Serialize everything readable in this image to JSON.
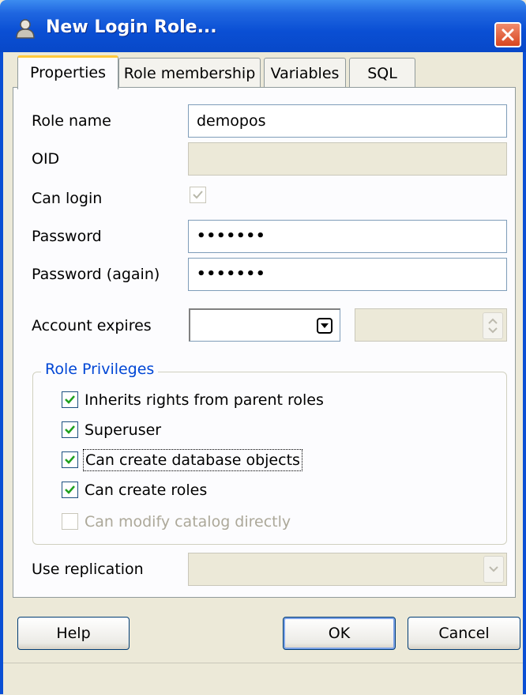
{
  "window": {
    "title": "New Login Role..."
  },
  "tabs": [
    {
      "label": "Properties",
      "active": true
    },
    {
      "label": "Role membership",
      "active": false
    },
    {
      "label": "Variables",
      "active": false
    },
    {
      "label": "SQL",
      "active": false
    }
  ],
  "form": {
    "role_name": {
      "label": "Role name",
      "value": "demopos"
    },
    "oid": {
      "label": "OID",
      "value": ""
    },
    "can_login": {
      "label": "Can login",
      "checked": true,
      "enabled": false
    },
    "password": {
      "label": "Password",
      "value": "•••••••"
    },
    "password_again": {
      "label": "Password (again)",
      "value": "•••••••"
    },
    "account_expires": {
      "label": "Account expires",
      "date": "",
      "time": ""
    },
    "use_replication": {
      "label": "Use replication",
      "value": ""
    }
  },
  "privileges": {
    "title": "Role Privileges",
    "items": [
      {
        "label": "Inherits rights from parent roles",
        "checked": true,
        "enabled": true
      },
      {
        "label": "Superuser",
        "checked": true,
        "enabled": true
      },
      {
        "label": "Can create database objects",
        "checked": true,
        "enabled": true,
        "focused": true
      },
      {
        "label": "Can create roles",
        "checked": true,
        "enabled": true
      },
      {
        "label": "Can modify catalog directly",
        "checked": false,
        "enabled": false
      }
    ]
  },
  "buttons": {
    "help": "Help",
    "ok": "OK",
    "cancel": "Cancel"
  },
  "colors": {
    "title_bar": "#0A4FD4",
    "accent_tab": "#FFC83C",
    "group_title": "#0046D5",
    "check": "#21A121"
  }
}
